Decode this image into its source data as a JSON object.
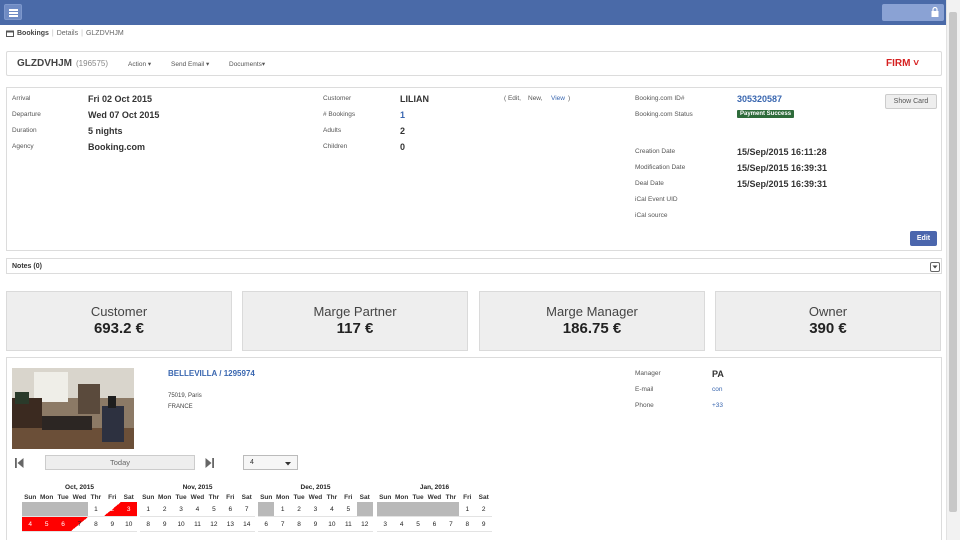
{
  "breadcrumbs": {
    "root": "Bookings",
    "details": "Details",
    "ref": "GLZDVHJM"
  },
  "header": {
    "reference": "GLZDVHJM",
    "number": "(196575)",
    "menus": [
      "Action ▾",
      "Send Email ▾",
      "Documents▾"
    ],
    "status": "FIRM ˅"
  },
  "stay": {
    "arrival_label": "Arrival",
    "arrival": "Fri 02 Oct 2015",
    "departure_label": "Departure",
    "departure": "Wed 07 Oct 2015",
    "duration_label": "Duration",
    "duration": "5 nights",
    "agency_label": "Agency",
    "agency": "Booking.com"
  },
  "customer": {
    "customer_label": "Customer",
    "name": "LILIAN",
    "paren_open": "( Edit,",
    "new_link": "New,",
    "view_link": "View",
    "paren_close": ")",
    "bookings_label": "# Bookings",
    "bookings": "1",
    "adults_label": "Adults",
    "adults": "2",
    "children_label": "Children",
    "children": "0"
  },
  "channel": {
    "id_label": "Booking.com ID#",
    "id": "305320587",
    "status_label": "Booking.com Status",
    "status": "Payment Success",
    "creation_label": "Creation Date",
    "creation": "15/Sep/2015 16:11:28",
    "modification_label": "Modification Date",
    "modification": "15/Sep/2015 16:39:31",
    "deal_label": "Deal Date",
    "deal": "15/Sep/2015 16:39:31",
    "ical_uid_label": "iCal Event UID",
    "ical_source_label": "iCal source",
    "show_card": "Show Card",
    "edit": "Edit"
  },
  "notes": {
    "label": "Notes (0)"
  },
  "stats": [
    {
      "title": "Customer",
      "value": "693.2 €"
    },
    {
      "title": "Marge Partner",
      "value": "117 €"
    },
    {
      "title": "Marge Manager",
      "value": "186.75 €"
    },
    {
      "title": "Owner",
      "value": "390 €"
    }
  ],
  "property": {
    "title": "BELLEVILLA / 1295974",
    "address1": "75019, Paris",
    "address2": "FRANCE",
    "manager_label": "Manager",
    "manager": "PA",
    "email_label": "E-mail",
    "email": "con",
    "phone_label": "Phone",
    "phone": "+33",
    "today": "Today",
    "months_select": "4"
  },
  "calendar": {
    "day_headers": [
      "Sun",
      "Mon",
      "Tue",
      "Wed",
      "Thr",
      "Fri",
      "Sat"
    ],
    "months": [
      {
        "title": "Oct, 2015",
        "weeks": [
          [
            "",
            "",
            "",
            "",
            "1",
            "2",
            "3"
          ],
          [
            "4",
            "5",
            "6",
            "7",
            "8",
            "9",
            "10"
          ]
        ]
      },
      {
        "title": "Nov, 2015",
        "weeks": [
          [
            "1",
            "2",
            "3",
            "4",
            "5",
            "6",
            "7"
          ],
          [
            "8",
            "9",
            "10",
            "11",
            "12",
            "13",
            "14"
          ]
        ]
      },
      {
        "title": "Dec, 2015",
        "weeks": [
          [
            "",
            "1",
            "2",
            "3",
            "4",
            "5",
            ""
          ],
          [
            "6",
            "7",
            "8",
            "9",
            "10",
            "11",
            "12"
          ]
        ]
      },
      {
        "title": "Jan, 2016",
        "weeks": [
          [
            "",
            "",
            "",
            "",
            "",
            "1",
            "2"
          ],
          [
            "3",
            "4",
            "5",
            "6",
            "7",
            "8",
            "9"
          ]
        ]
      }
    ]
  },
  "colors": {
    "topbar": "#4a6aa8",
    "booked": "#ff0000",
    "status_firm": "#d62020",
    "link": "#3a67b0"
  }
}
